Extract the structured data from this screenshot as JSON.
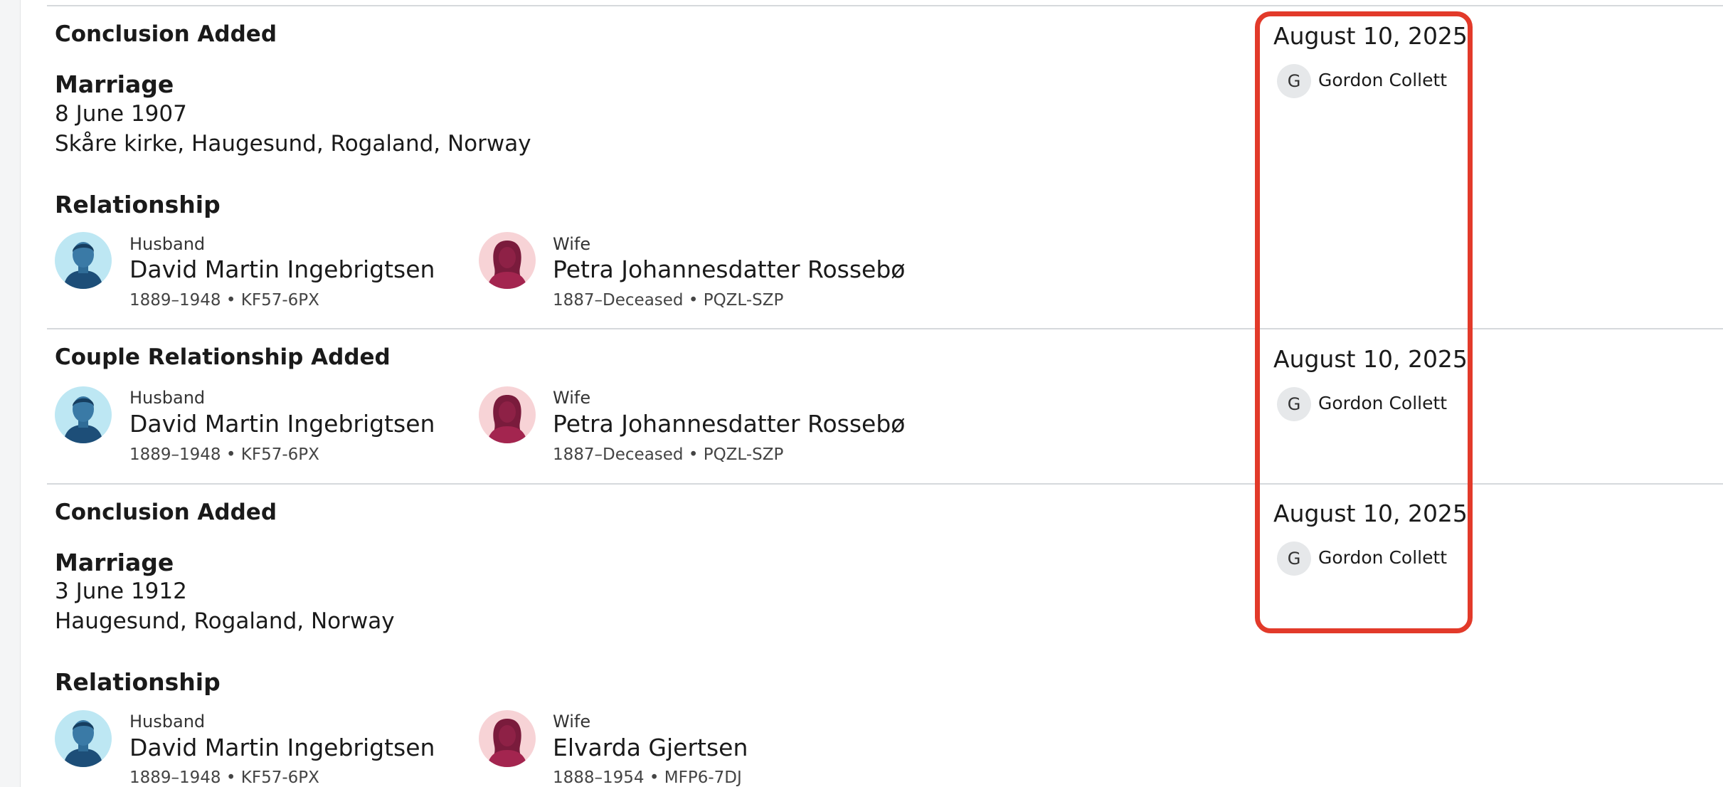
{
  "entries": [
    {
      "type": "Conclusion Added",
      "event": {
        "title": "Marriage",
        "date": "8 June 1907",
        "place": "Skåre kirke, Haugesund, Rogaland, Norway"
      },
      "section": "Relationship",
      "husband": {
        "role": "Husband",
        "name": "David Martin Ingebrigtsen",
        "meta": "1889–1948 • KF57-6PX"
      },
      "wife": {
        "role": "Wife",
        "name": "Petra Johannesdatter Rossebø",
        "meta": "1887–Deceased • PQZL-SZP"
      },
      "date": "August 10, 2025",
      "user": {
        "initial": "G",
        "name": "Gordon Collett"
      }
    },
    {
      "type": "Couple Relationship Added",
      "husband": {
        "role": "Husband",
        "name": "David Martin Ingebrigtsen",
        "meta": "1889–1948 • KF57-6PX"
      },
      "wife": {
        "role": "Wife",
        "name": "Petra Johannesdatter Rossebø",
        "meta": "1887–Deceased • PQZL-SZP"
      },
      "date": "August 10, 2025",
      "user": {
        "initial": "G",
        "name": "Gordon Collett"
      }
    },
    {
      "type": "Conclusion Added",
      "event": {
        "title": "Marriage",
        "date": "3 June 1912",
        "place": "Haugesund, Rogaland, Norway"
      },
      "section": "Relationship",
      "husband": {
        "role": "Husband",
        "name": "David Martin Ingebrigtsen",
        "meta": "1889–1948 • KF57-6PX"
      },
      "wife": {
        "role": "Wife",
        "name": "Elvarda Gjertsen",
        "meta": "1888–1954 • MFP6-7DJ"
      },
      "date": "August 10, 2025",
      "user": {
        "initial": "G",
        "name": "Gordon Collett"
      }
    }
  ],
  "colors": {
    "highlight": "#e23a2a",
    "male_avatar_bg": "#bde7f3",
    "female_avatar_bg": "#f7d3d6"
  }
}
